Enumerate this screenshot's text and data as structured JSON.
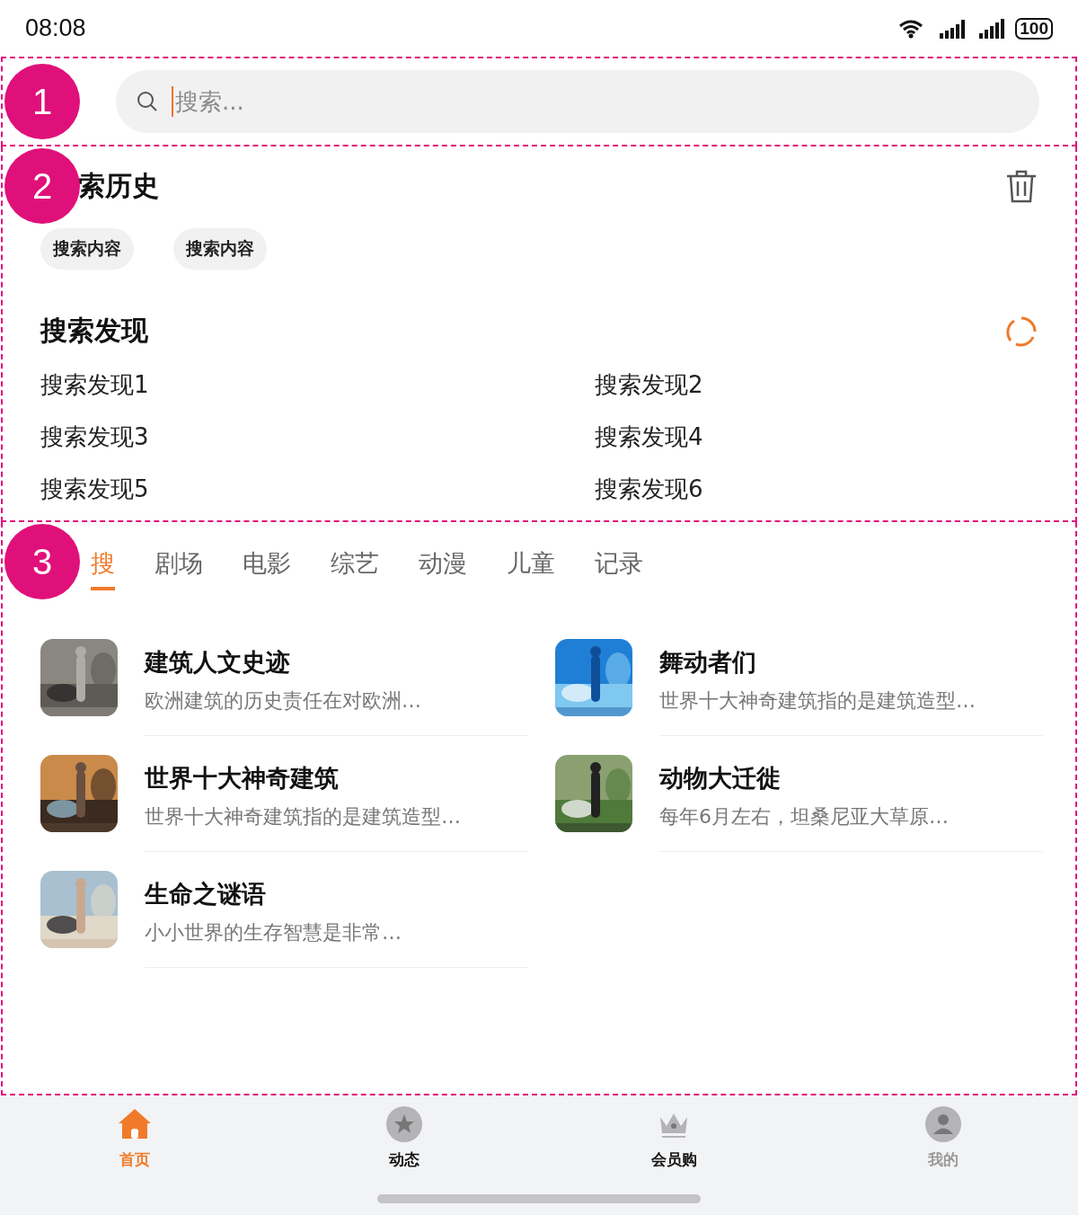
{
  "status_bar": {
    "time": "08:08",
    "battery": "100"
  },
  "search": {
    "marker": "1",
    "placeholder": "搜索..."
  },
  "history": {
    "marker": "2",
    "title": "索历史",
    "chips": [
      "搜索内容",
      "搜索内容"
    ]
  },
  "discover": {
    "title": "搜索发现",
    "items": [
      "搜索发现1",
      "搜索发现2",
      "搜索发现3",
      "搜索发现4",
      "搜索发现5",
      "搜索发现6"
    ]
  },
  "content": {
    "marker": "3",
    "tabs": [
      {
        "label": "搜",
        "selected": true
      },
      {
        "label": "剧场",
        "selected": false
      },
      {
        "label": "电影",
        "selected": false
      },
      {
        "label": "综艺",
        "selected": false
      },
      {
        "label": "动漫",
        "selected": false
      },
      {
        "label": "儿童",
        "selected": false
      },
      {
        "label": "记录",
        "selected": false
      }
    ],
    "items": [
      {
        "title": "建筑人文史迹",
        "subtitle": "欧洲建筑的历史责任在对欧洲…"
      },
      {
        "title": "舞动者们",
        "subtitle": "世界十大神奇建筑指的是建筑造型…"
      },
      {
        "title": "世界十大神奇建筑",
        "subtitle": "世界十大神奇建筑指的是建筑造型…"
      },
      {
        "title": "动物大迁徙",
        "subtitle": "每年6月左右，坦桑尼亚大草原…"
      },
      {
        "title": "生命之谜语",
        "subtitle": "小小世界的生存智慧是非常…"
      }
    ]
  },
  "bottom_nav": [
    {
      "kind": "home",
      "label": "首页",
      "selected": true,
      "dimmed": false
    },
    {
      "kind": "star",
      "label": "动态",
      "selected": false,
      "dimmed": false
    },
    {
      "kind": "crown",
      "label": "会员购",
      "selected": false,
      "dimmed": false
    },
    {
      "kind": "user",
      "label": "我的",
      "selected": false,
      "dimmed": true
    }
  ]
}
